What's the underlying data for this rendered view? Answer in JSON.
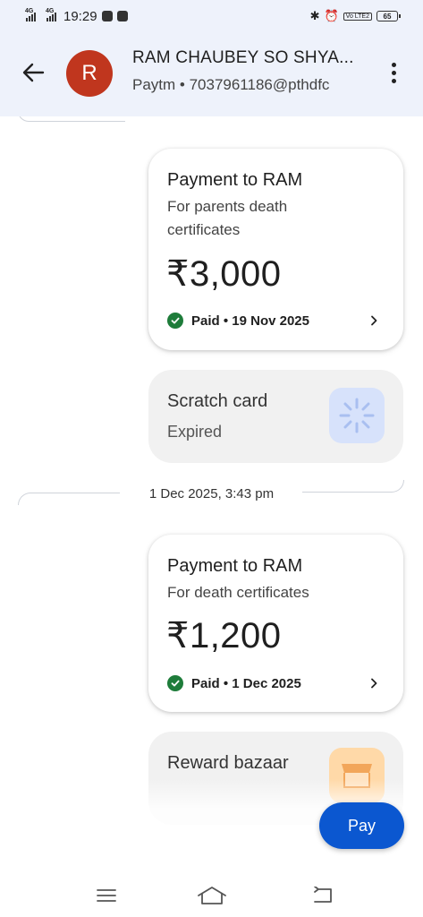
{
  "status_bar": {
    "net1": "4G",
    "net2": "4G",
    "time": "19:29",
    "volte": "Vo LTE2",
    "battery": "65"
  },
  "header": {
    "avatar_letter": "R",
    "contact_name": "RAM CHAUBEY SO SHYA...",
    "contact_sub": "Paytm • 7037961186@pthdfc"
  },
  "messages": {
    "payment1": {
      "title": "Payment to RAM",
      "note": "For parents death certificates",
      "amount": "₹3,000",
      "status": "Paid • 19 Nov 2025"
    },
    "scratch_card": {
      "title": "Scratch card",
      "subtitle": "Expired"
    },
    "date_separator": "1 Dec 2025, 3:43 pm",
    "payment2": {
      "title": "Payment to RAM",
      "note": "For death certificates",
      "amount": "₹1,200",
      "status": "Paid • 1 Dec 2025"
    },
    "reward_bazaar": {
      "title": "Reward bazaar"
    }
  },
  "actions": {
    "pay_label": "Pay"
  },
  "colors": {
    "header_bg": "#eef2fb",
    "avatar_bg": "#c0361e",
    "paid_green": "#1e7c3a",
    "pay_button": "#0b57d0"
  },
  "icons": [
    "back-arrow-icon",
    "more-vert-icon",
    "check-circle-icon",
    "chevron-right-icon",
    "scratch-card-icon",
    "store-icon",
    "menu-icon",
    "home-icon",
    "back-nav-icon"
  ]
}
